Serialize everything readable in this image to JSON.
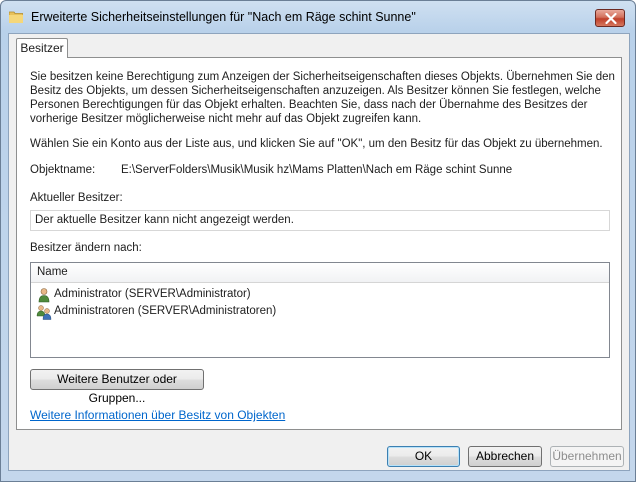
{
  "window": {
    "title": "Erweiterte Sicherheitseinstellungen für \"Nach em Räge schint Sunne\"",
    "icon": "folder-icon"
  },
  "tabs": [
    {
      "label": "Besitzer",
      "selected": true
    }
  ],
  "owner_tab": {
    "intro": "Sie besitzen keine Berechtigung zum Anzeigen der Sicherheitseigenschaften dieses Objekts. Übernehmen Sie den Besitz des Objekts, um dessen Sicherheitseigenschaften anzuzeigen. Als Besitzer können Sie festlegen, welche Personen Berechtigungen für das Objekt erhalten. Beachten Sie, dass nach der Übernahme des Besitzes der vorherige Besitzer möglicherweise nicht mehr auf das Objekt zugreifen kann.",
    "choose_account": "Wählen Sie ein Konto aus der Liste aus, und klicken Sie auf \"OK\", um den Besitz für das Objekt zu übernehmen.",
    "object_name_label": "Objektname:",
    "object_name_value": "E:\\ServerFolders\\Musik\\Musik hz\\Mams Platten\\Nach em Räge schint Sunne",
    "current_owner_label": "Aktueller Besitzer:",
    "current_owner_value": "Der aktuelle Besitzer kann nicht angezeigt werden.",
    "change_owner_label": "Besitzer ändern nach:",
    "list_header": "Name",
    "list_items": [
      {
        "label": "Administrator (SERVER\\Administrator)",
        "icon": "user-icon"
      },
      {
        "label": "Administratoren (SERVER\\Administratoren)",
        "icon": "user-group-icon"
      }
    ],
    "more_users_button": "Weitere Benutzer oder Gruppen...",
    "info_link": "Weitere Informationen über Besitz von Objekten"
  },
  "footer": {
    "ok": "OK",
    "cancel": "Abbrechen",
    "apply": "Übernehmen",
    "apply_enabled": false
  },
  "colors": {
    "link": "#0066cc",
    "close_button": "#c0402a"
  }
}
